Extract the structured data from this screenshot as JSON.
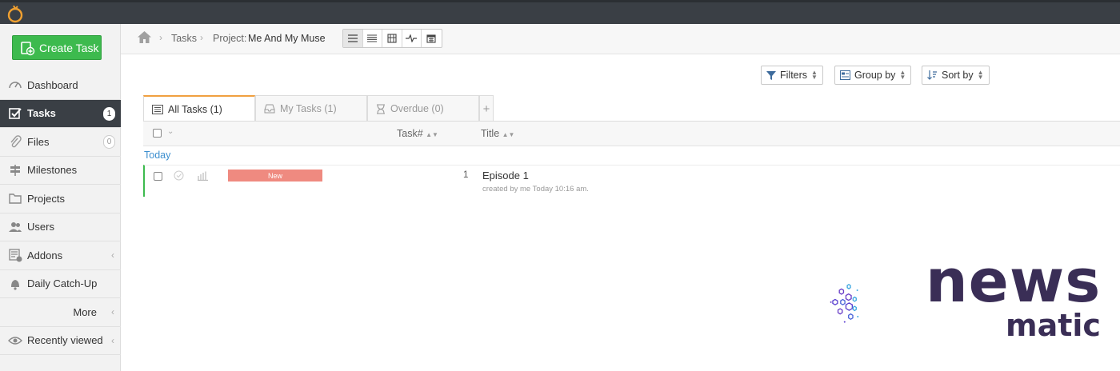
{
  "sidebar": {
    "create_label": "Create Task",
    "items": [
      {
        "label": "Dashboard"
      },
      {
        "label": "Tasks",
        "count": "1"
      },
      {
        "label": "Files",
        "count": "0"
      },
      {
        "label": "Milestones"
      },
      {
        "label": "Projects"
      },
      {
        "label": "Users"
      },
      {
        "label": "Addons"
      },
      {
        "label": "Daily Catch-Up"
      },
      {
        "label": "More"
      },
      {
        "label": "Recently viewed"
      }
    ]
  },
  "breadcrumb": {
    "tasks": "Tasks",
    "project_prefix": "Project:",
    "project_name": "Me And My Muse"
  },
  "toolbar": {
    "filters": "Filters",
    "group_by": "Group by",
    "sort_by": "Sort by"
  },
  "tabs": [
    {
      "label": "All Tasks (1)"
    },
    {
      "label": "My Tasks (1)"
    },
    {
      "label": "Overdue (0)"
    },
    {
      "label": "+"
    }
  ],
  "table": {
    "columns": {
      "task_num": "Task#",
      "title": "Title"
    },
    "group_label": "Today",
    "rows": [
      {
        "status": "New",
        "task_num": "1",
        "title": "Episode 1",
        "meta": "created by me Today 10:16 am."
      }
    ]
  },
  "brand": {
    "word1": "news",
    "word2": "matic"
  },
  "colors": {
    "accent_green": "#3dba4e",
    "sidebar_active": "#3a3f45",
    "status_new": "#ef8a80",
    "tab_active_border": "#f0a040",
    "link_blue": "#3d8fcf",
    "brand_purple": "#3a2e56"
  }
}
